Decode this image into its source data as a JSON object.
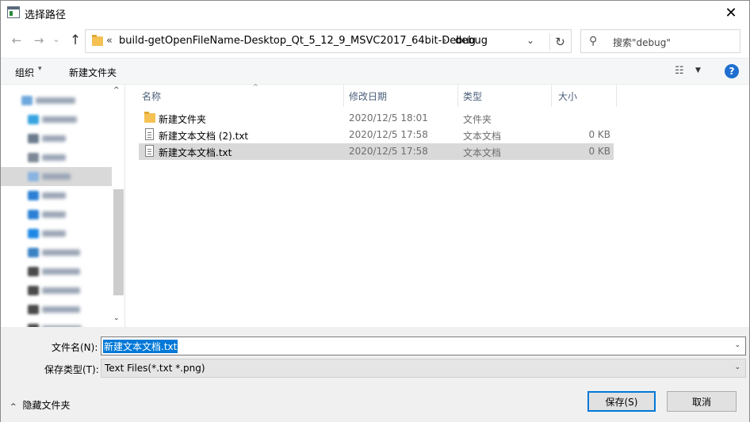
{
  "window": {
    "title": "选择路径",
    "close_glyph": "✕"
  },
  "nav": {
    "back_glyph": "←",
    "forward_glyph": "→",
    "history_glyph": "⌄",
    "up_glyph": "↑",
    "breadcrumb_overflow": "«",
    "breadcrumbs": [
      "build-getOpenFileName-Desktop_Qt_5_12_9_MSVC2017_64bit-Debug",
      "debug"
    ],
    "breadcrumb_separator": "›",
    "dropdown_glyph": "⌄",
    "refresh_glyph": "↻",
    "search_placeholder": "搜索\"debug\"",
    "search_glyph": "⚲"
  },
  "toolbar": {
    "organize": "组织",
    "organize_arrow": "▾",
    "new_folder": "新建文件夹",
    "view_glyph": "☷",
    "view_arrow": "▼",
    "help": "?"
  },
  "columns": {
    "name": "名称",
    "date": "修改日期",
    "type": "类型",
    "size": "大小",
    "sort_glyph": "^"
  },
  "files": [
    {
      "name": "新建文件夹",
      "date": "2020/12/5 18:01",
      "type": "文件夹",
      "size": "",
      "kind": "folder"
    },
    {
      "name": "新建文本文档 (2).txt",
      "date": "2020/12/5 17:58",
      "type": "文本文档",
      "size": "0 KB",
      "kind": "file"
    },
    {
      "name": "新建文本文档.txt",
      "date": "2020/12/5 17:58",
      "type": "文本文档",
      "size": "0 KB",
      "kind": "file",
      "selected": true
    }
  ],
  "navpane": {
    "scroll_up": "^",
    "scroll_down": "⌄",
    "icon_colors": [
      "#6fa8dc",
      "#36a3e0",
      "#6b7b8c",
      "#7d8896",
      "#8ab4e0",
      "#2b7fd4",
      "#2b7fd4",
      "#1e88e5",
      "#3a82c4",
      "#4a4a4a",
      "#4a4a4a",
      "#4a4a4a",
      "#4a4a4a"
    ]
  },
  "bottom": {
    "filename_label": "文件名(N):",
    "filename_value": "新建文本文档.txt",
    "filetype_label": "保存类型(T):",
    "filetype_value": "Text Files(*.txt *.png)",
    "dropdown_glyph": "⌄",
    "hide_folders_arrow": "^",
    "hide_folders": "隐藏文件夹",
    "save_button": "保存(S)",
    "cancel_button": "取消"
  }
}
